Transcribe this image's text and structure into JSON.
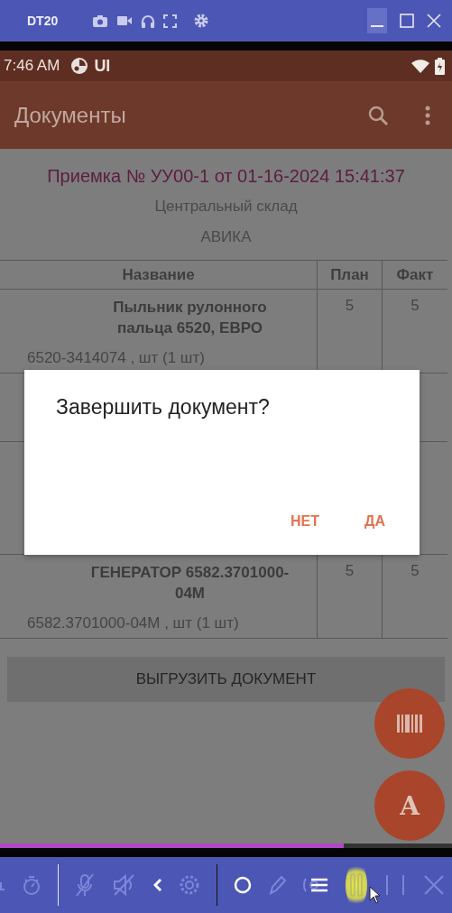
{
  "window": {
    "title": "DT20"
  },
  "status_bar": {
    "time": "7:46 AM",
    "label": "UI"
  },
  "app_bar": {
    "title": "Документы"
  },
  "document": {
    "title": "Приемка № УУ00-1 от 01-16-2024 15:41:37",
    "warehouse": "Центральный склад",
    "supplier": "АВИКА"
  },
  "table": {
    "columns": [
      "Название",
      "План",
      "Факт"
    ],
    "rows": [
      {
        "name": "Пыльник рулонного пальца 6520, ЕВРО",
        "code": "6520-3414074 , шт (1 шт)",
        "plan": "5",
        "fact": "5"
      },
      {
        "name": "ГЕНЕРАТОР 6582.3701000-04М",
        "code": "6582.3701000-04М , шт (1 шт)",
        "plan": "5",
        "fact": "5"
      }
    ]
  },
  "upload_button": "ВЫГРУЗИТЬ ДОКУМЕНТ",
  "fab_label": "A",
  "dialog": {
    "message": "Завершить документ?",
    "buttons": [
      "НЕТ",
      "ДА"
    ]
  },
  "playback": {
    "level": 0.76
  }
}
